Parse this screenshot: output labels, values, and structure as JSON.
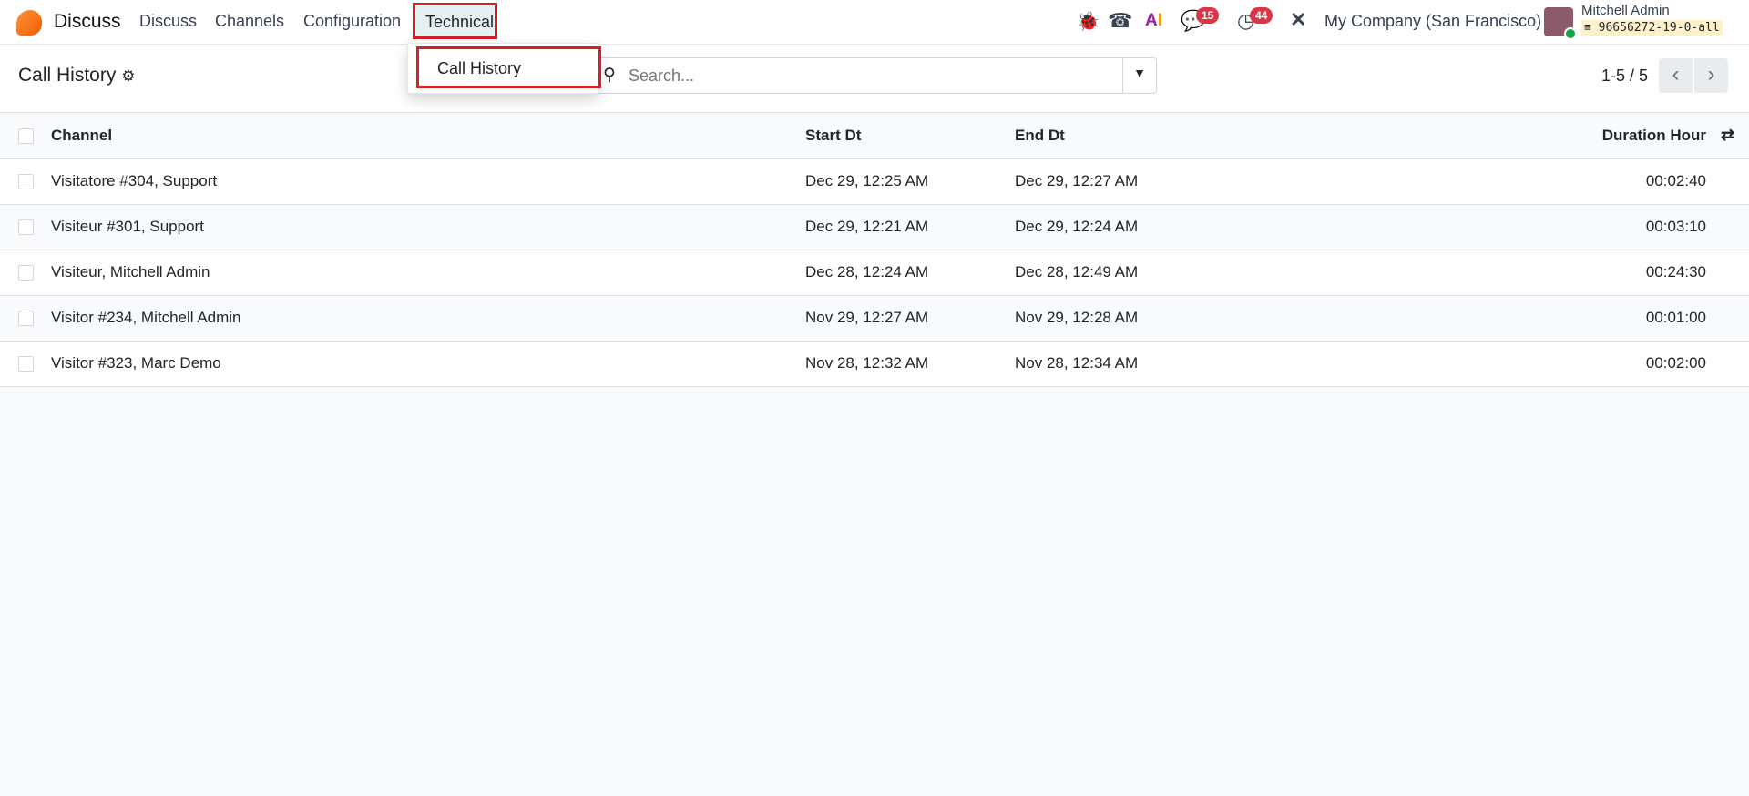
{
  "navbar": {
    "brand": "Discuss",
    "menu": [
      "Discuss",
      "Channels",
      "Configuration",
      "Technical"
    ],
    "dropdown_item": "Call History",
    "chat_badge": "15",
    "activity_badge": "44",
    "company": "My Company (San Francisco)",
    "user_name": "Mitchell Admin",
    "database": "96656272-19-0-all"
  },
  "control": {
    "title": "Call History",
    "search_placeholder": "Search...",
    "pager": "1-5 / 5"
  },
  "table": {
    "headers": [
      "Channel",
      "Start Dt",
      "End Dt",
      "Duration Hour"
    ],
    "rows": [
      [
        "Visitatore #304, Support",
        "Dec 29, 12:25 AM",
        "Dec 29, 12:27 AM",
        "00:02:40"
      ],
      [
        "Visiteur #301, Support",
        "Dec 29, 12:21 AM",
        "Dec 29, 12:24 AM",
        "00:03:10"
      ],
      [
        "Visiteur, Mitchell Admin",
        "Dec 28, 12:24 AM",
        "Dec 28, 12:49 AM",
        "00:24:30"
      ],
      [
        "Visitor #234, Mitchell Admin",
        "Nov 29, 12:27 AM",
        "Nov 29, 12:28 AM",
        "00:01:00"
      ],
      [
        "Visitor #323, Marc Demo",
        "Nov 28, 12:32 AM",
        "Nov 28, 12:34 AM",
        "00:02:00"
      ]
    ]
  }
}
